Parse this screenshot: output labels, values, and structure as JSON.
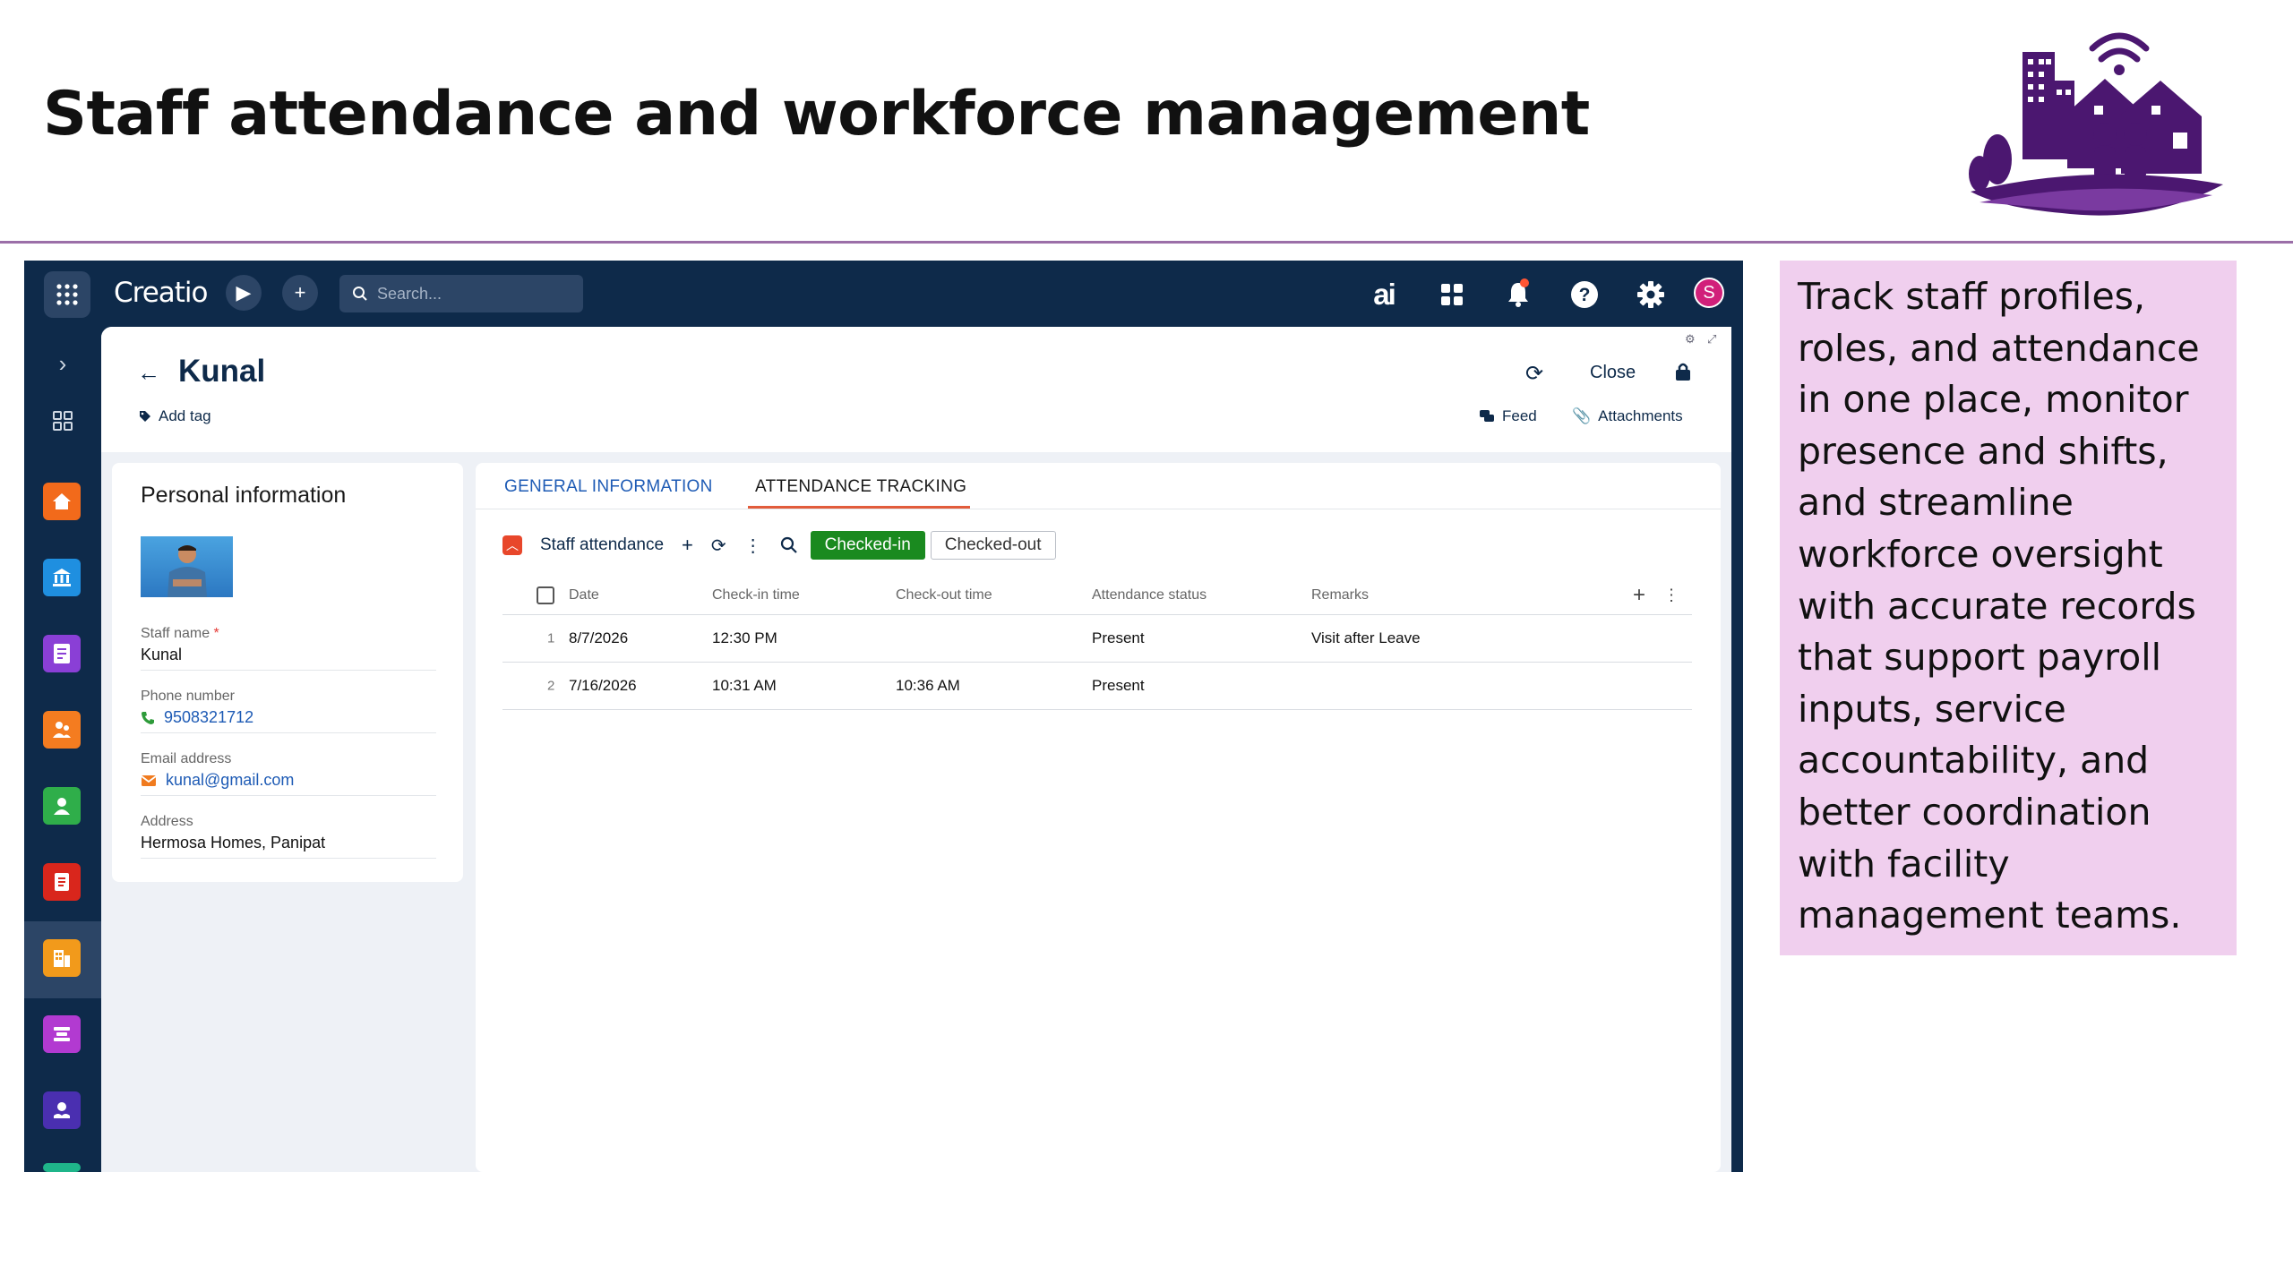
{
  "slide": {
    "title": "Staff attendance and workforce management",
    "description": "Track staff profiles, roles, and attendance in one place, monitor presence and shifts, and streamline workforce oversight with accurate records that support payroll inputs, service accountability, and better coordination with facility management teams."
  },
  "colors": {
    "accent_purple": "#4b1770",
    "nav_bg": "#0e2a4a",
    "callout_bg": "#f0cfee",
    "checked_in": "#1a8a1f"
  },
  "app": {
    "brand": "Creatio",
    "search_placeholder": "Search...",
    "ai_label": "ai",
    "avatar_initial": "S"
  },
  "record": {
    "title": "Kunal",
    "add_tag": "Add tag",
    "close_label": "Close",
    "feed_label": "Feed",
    "attachments_label": "Attachments"
  },
  "personal": {
    "title": "Personal information",
    "staff_name_label": "Staff name",
    "staff_name_required": "*",
    "staff_name": "Kunal",
    "phone_label": "Phone number",
    "phone": "9508321712",
    "email_label": "Email address",
    "email": "kunal@gmail.com",
    "address_label": "Address",
    "address": "Hermosa Homes, Panipat"
  },
  "tabs": [
    {
      "label": "GENERAL INFORMATION",
      "active": false
    },
    {
      "label": "ATTENDANCE TRACKING",
      "active": true
    }
  ],
  "attendance": {
    "title": "Staff attendance",
    "filter_checked_in": "Checked-in",
    "filter_checked_out": "Checked-out",
    "columns": [
      "Date",
      "Check-in time",
      "Check-out time",
      "Attendance status",
      "Remarks"
    ],
    "rows": [
      {
        "num": "1",
        "date": "8/7/2026",
        "check_in": "12:30 PM",
        "check_out": "",
        "status": "Present",
        "remarks": "Visit after Leave"
      },
      {
        "num": "2",
        "date": "7/16/2026",
        "check_in": "10:31 AM",
        "check_out": "10:36 AM",
        "status": "Present",
        "remarks": ""
      }
    ]
  },
  "nav_icons": [
    "expand-icon",
    "grid-icon",
    "home-icon",
    "bank-icon",
    "form-icon",
    "people-icon",
    "contact-icon",
    "document-icon",
    "building-icon",
    "layers-icon",
    "handshake-icon"
  ]
}
